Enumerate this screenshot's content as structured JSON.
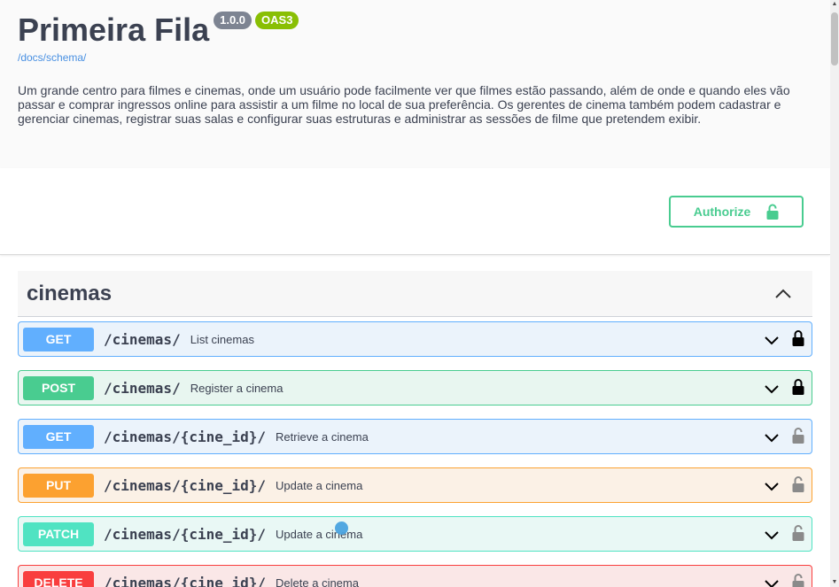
{
  "info": {
    "title": "Primeira Fila",
    "version": "1.0.0",
    "oas_badge": "OAS3",
    "schema_link": "/docs/schema/",
    "description": "Um grande centro para filmes e cinemas, onde um usuário pode facilmente ver que filmes estão passando, além de onde e quando eles vão passar e comprar ingressos online para assistir a um filme no local de sua preferência. Os gerentes de cinema também podem cadastrar e gerenciar cinemas, registrar suas salas e configurar suas estruturas e administrar as sessões de filme que pretendem exibir."
  },
  "authorize": {
    "label": "Authorize",
    "icon": "unlocked-padlock-icon"
  },
  "tag": {
    "name": "cinemas",
    "state": "expanded"
  },
  "operations": [
    {
      "method": "GET",
      "path": "/cinemas/",
      "summary": "List cinemas",
      "lock": "locked"
    },
    {
      "method": "POST",
      "path": "/cinemas/",
      "summary": "Register a cinema",
      "lock": "locked"
    },
    {
      "method": "GET",
      "path": "/cinemas/{cine_id}/",
      "summary": "Retrieve a cinema",
      "lock": "unlocked"
    },
    {
      "method": "PUT",
      "path": "/cinemas/{cine_id}/",
      "summary": "Update a cinema",
      "lock": "unlocked"
    },
    {
      "method": "PATCH",
      "path": "/cinemas/{cine_id}/",
      "summary": "Update a cinema",
      "lock": "unlocked"
    },
    {
      "method": "DELETE",
      "path": "/cinemas/{cine_id}/",
      "summary": "Delete a cinema",
      "lock": "unlocked"
    }
  ],
  "colors": {
    "get": "#61affe",
    "post": "#49cc90",
    "put": "#fca130",
    "patch": "#50e3c2",
    "delete": "#f93e3e",
    "authorize": "#49cc90",
    "text": "#3b4151",
    "link": "#4990e2"
  }
}
